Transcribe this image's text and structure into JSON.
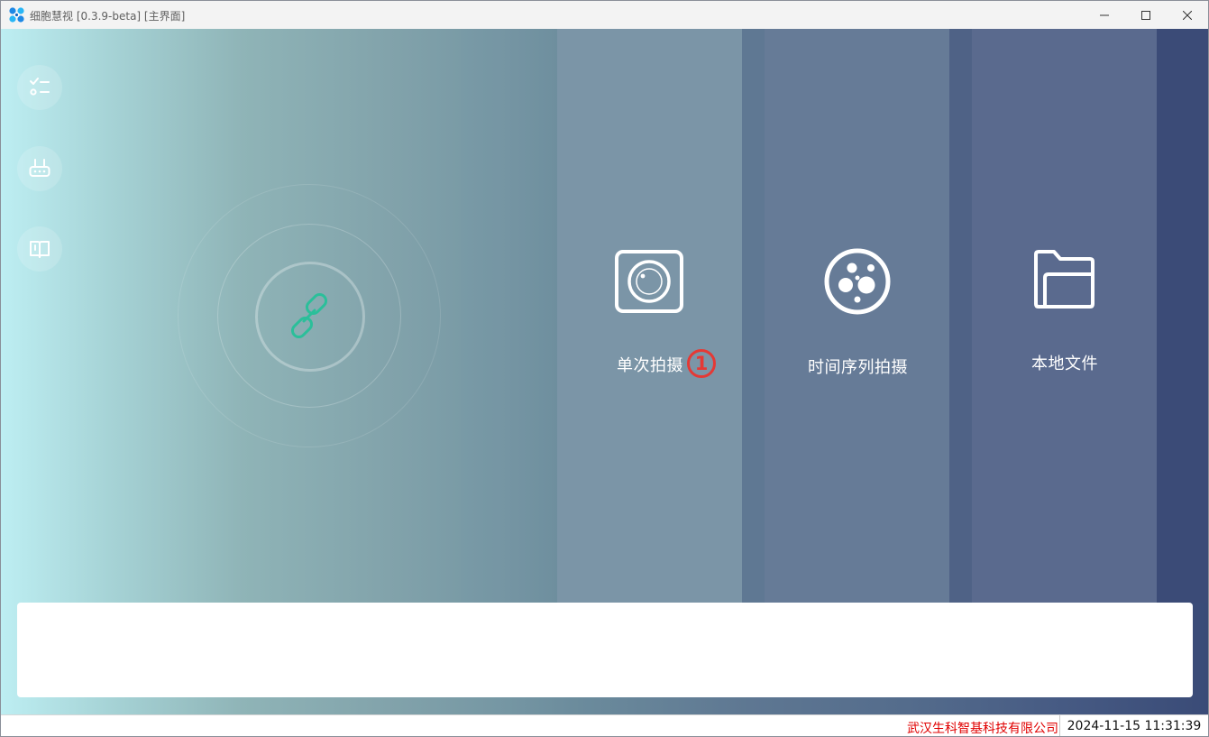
{
  "window": {
    "title": "细胞慧视 [0.3.9-beta] [主界面]",
    "controls": [
      "minimize",
      "maximize",
      "close"
    ]
  },
  "sidebar": {
    "items": [
      {
        "icon": "checklist-icon"
      },
      {
        "icon": "device-icon"
      },
      {
        "icon": "manual-book-icon"
      }
    ]
  },
  "connection": {
    "icon": "link-icon",
    "accent": "#2bbf9a"
  },
  "tiles": [
    {
      "label": "单次拍摄",
      "icon": "camera-icon"
    },
    {
      "label": "时间序列拍摄",
      "icon": "film-reel-icon"
    },
    {
      "label": "本地文件",
      "icon": "folder-icon"
    }
  ],
  "annotation": {
    "marker": "1",
    "color": "#e53935"
  },
  "log": {
    "text": ""
  },
  "status": {
    "company": "武汉生科智基科技有限公司",
    "datetime": "2024-11-15 11:31:39",
    "company_color": "#e00000"
  }
}
